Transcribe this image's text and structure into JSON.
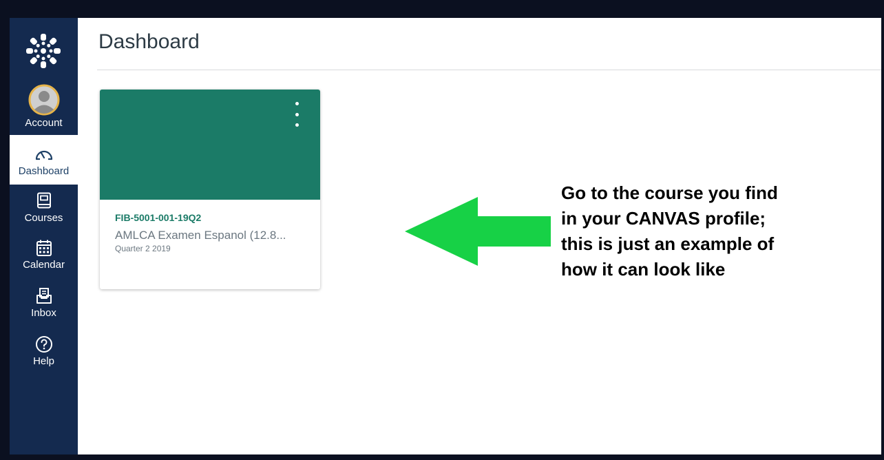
{
  "nav": {
    "items": [
      {
        "id": "account",
        "label": "Account",
        "icon": "avatar-icon"
      },
      {
        "id": "dashboard",
        "label": "Dashboard",
        "icon": "speedometer-icon",
        "active": true
      },
      {
        "id": "courses",
        "label": "Courses",
        "icon": "book-icon"
      },
      {
        "id": "calendar",
        "label": "Calendar",
        "icon": "calendar-icon"
      },
      {
        "id": "inbox",
        "label": "Inbox",
        "icon": "inbox-icon"
      },
      {
        "id": "help",
        "label": "Help",
        "icon": "help-icon"
      }
    ],
    "logo_icon": "canvas-logo-icon",
    "color": "#142a4f"
  },
  "main": {
    "title": "Dashboard",
    "card": {
      "code": "FIB-5001-001-19Q2",
      "name": "AMLCA Examen Espanol (12.8...",
      "term": "Quarter 2 2019",
      "color": "#1b7b67"
    }
  },
  "annotation": {
    "lines": [
      "Go to the course you find",
      "in your CANVAS profile;",
      "this is just an example of",
      "how it can look like"
    ],
    "arrow_color": "#17d146"
  }
}
